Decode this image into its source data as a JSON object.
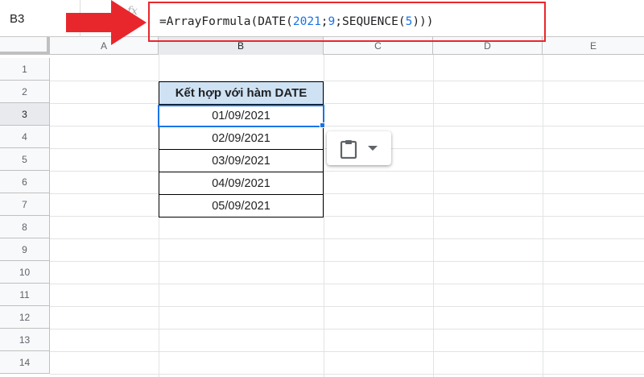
{
  "name_box": {
    "value": "B3"
  },
  "formula": {
    "icon": "fx-icon",
    "prefix": "=ArrayFormula(DATE(",
    "arg_year": "2021",
    "sep1": ";",
    "arg_month": "9",
    "sep2": ";SEQUENCE(",
    "arg_count": "5",
    "suffix": ")))"
  },
  "columns": [
    {
      "label": "",
      "name": "col-header-blank"
    },
    {
      "label": "A"
    },
    {
      "label": "B"
    },
    {
      "label": "C"
    },
    {
      "label": "D"
    },
    {
      "label": "E"
    }
  ],
  "column_labels": {
    "a": "A",
    "b": "B",
    "c": "C",
    "d": "D",
    "e": "E"
  },
  "rows": {
    "r1": "1",
    "r2": "2",
    "r3": "3",
    "r4": "4",
    "r5": "5",
    "r6": "6",
    "r7": "7",
    "r8": "8",
    "r9": "9",
    "r10": "10",
    "r11": "11",
    "r12": "12",
    "r13": "13",
    "r14": "14"
  },
  "table": {
    "header": "Kết hợp với hàm DATE",
    "values": [
      "01/09/2021",
      "02/09/2021",
      "03/09/2021",
      "04/09/2021",
      "05/09/2021"
    ]
  },
  "active_cell": {
    "column": "B",
    "row": "3"
  },
  "colors": {
    "highlight_box": "#e8272d",
    "arrow": "#e8272d",
    "selection": "#1a73e8",
    "header_fill": "#cfe2f3",
    "number_token": "#1a73e8"
  },
  "icons": {
    "paste_popup": [
      "clipboard-icon",
      "chevron-down-icon"
    ],
    "annotation": "red-arrow-icon"
  }
}
